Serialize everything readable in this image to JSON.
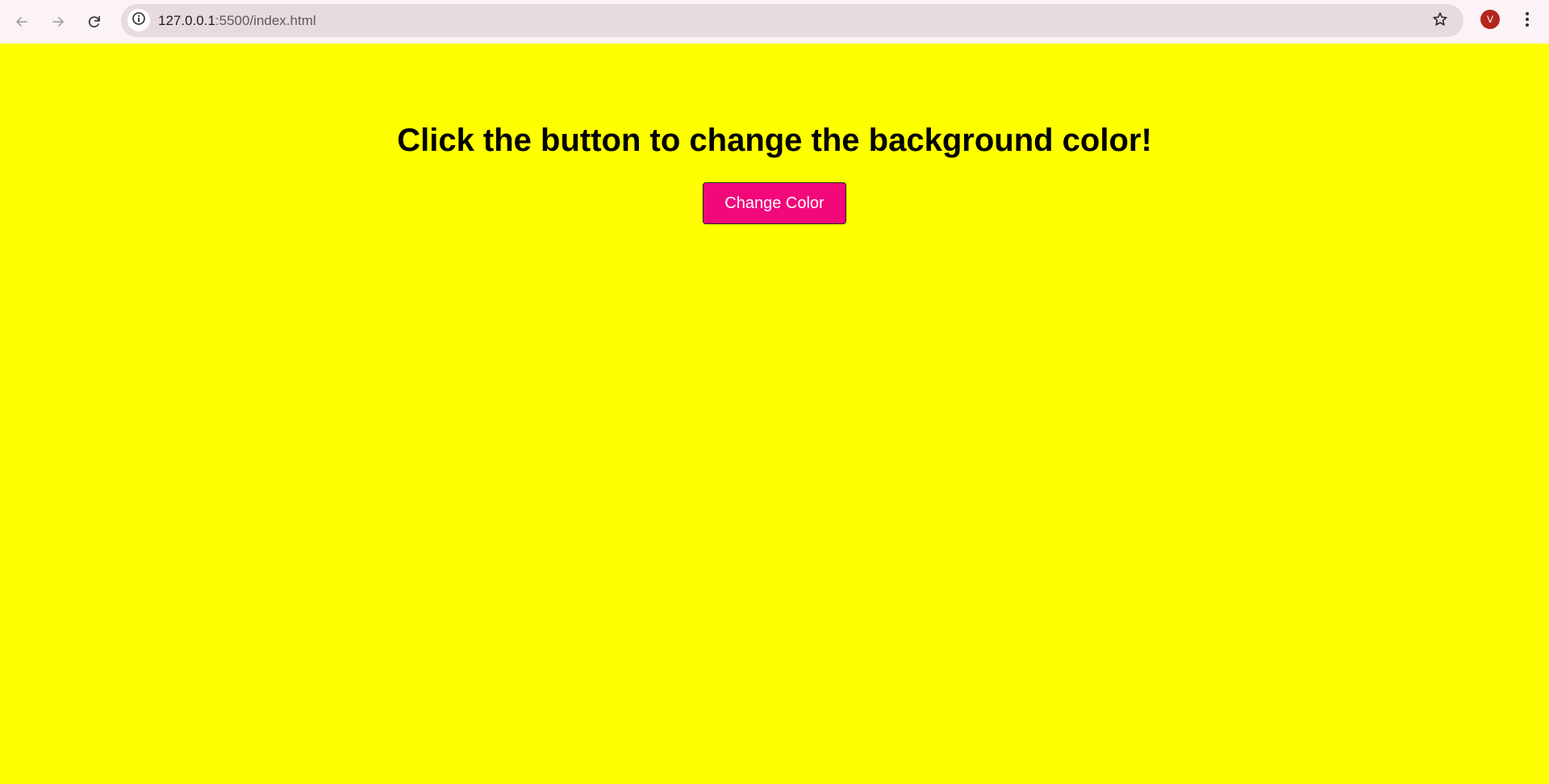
{
  "browser": {
    "url_host": "127.0.0.1",
    "url_path": ":5500/index.html",
    "profile_initial": "V",
    "icons": {
      "back": "arrow-left-icon",
      "forward": "arrow-right-icon",
      "reload": "reload-icon",
      "site_info": "info-icon",
      "bookmark": "star-icon",
      "menu": "kebab-menu-icon"
    },
    "colors": {
      "toolbar": "#fbf3f5",
      "omnibox": "#e8dbe0",
      "avatar": "#b3261e"
    }
  },
  "page": {
    "heading": "Click the button to change the background color!",
    "button_label": "Change Color",
    "colors": {
      "background": "#ffff00",
      "button": "#f3087a"
    }
  }
}
